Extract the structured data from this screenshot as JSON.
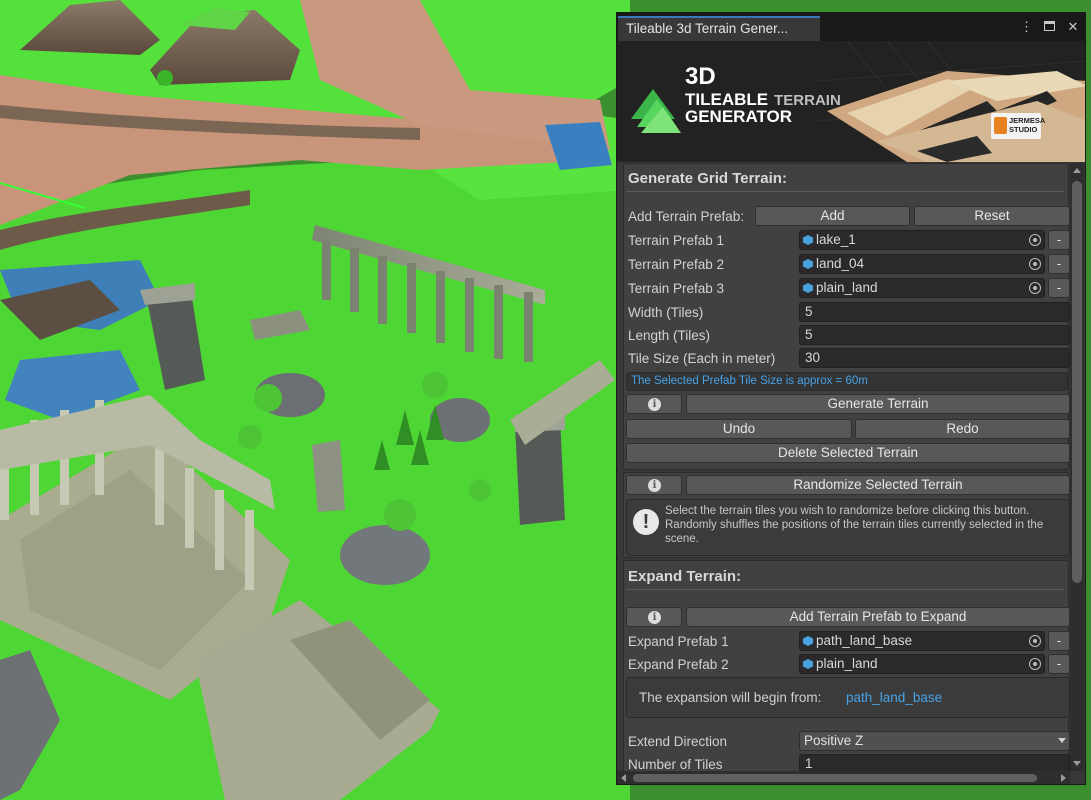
{
  "window": {
    "tab_title": "Tileable 3d Terrain Gener...",
    "menu_glyph": "⋮",
    "close_glyph": "✕"
  },
  "banner": {
    "line1": "3D",
    "line2": "TILEABLE",
    "line2b": "TERRAIN",
    "line3": "GENERATOR",
    "studio": "JERMESA",
    "studio_sub": "STUDIO"
  },
  "grid": {
    "title": "Generate Grid Terrain:",
    "add_prefab_label": "Add Terrain Prefab:",
    "add_button": "Add",
    "reset_button": "Reset",
    "prefabs": [
      {
        "label": "Terrain Prefab 1",
        "value": "lake_1"
      },
      {
        "label": "Terrain Prefab 2",
        "value": "land_04"
      },
      {
        "label": "Terrain Prefab 3",
        "value": "plain_land"
      }
    ],
    "remove_glyph": "-",
    "width_label": "Width (Tiles)",
    "width_value": "5",
    "length_label": "Length (Tiles)",
    "length_value": "5",
    "tile_size_label": "Tile Size (Each in meter)",
    "tile_size_value": "30",
    "hint": "The Selected Prefab Tile Size is approx = 60m",
    "info_glyph": "i",
    "generate_button": "Generate Terrain",
    "undo_button": "Undo",
    "redo_button": "Redo",
    "delete_button": "Delete Selected Terrain"
  },
  "randomize": {
    "button": "Randomize Selected Terrain",
    "warn_glyph": "!",
    "help_line1": "Select the terrain tiles you wish to randomize before clicking this button.",
    "help_line2": "Randomly shuffles the positions of the terrain tiles currently selected in the",
    "help_line3": "scene."
  },
  "expand": {
    "title": "Expand Terrain:",
    "add_button": "Add Terrain Prefab to Expand",
    "prefabs": [
      {
        "label": "Expand Prefab 1",
        "value": "path_land_base"
      },
      {
        "label": "Expand Prefab 2",
        "value": "plain_land"
      }
    ],
    "begin_text": "The expansion will begin from:",
    "begin_value": "path_land_base",
    "direction_label": "Extend Direction",
    "direction_value": "Positive Z",
    "count_label": "Number of Tiles",
    "count_value": "1"
  },
  "colors": {
    "accent": "#3a79bb",
    "hint_text": "#46a3e8",
    "panel_bg": "#383838",
    "grass": "#52e53a",
    "path": "#c8947a"
  }
}
